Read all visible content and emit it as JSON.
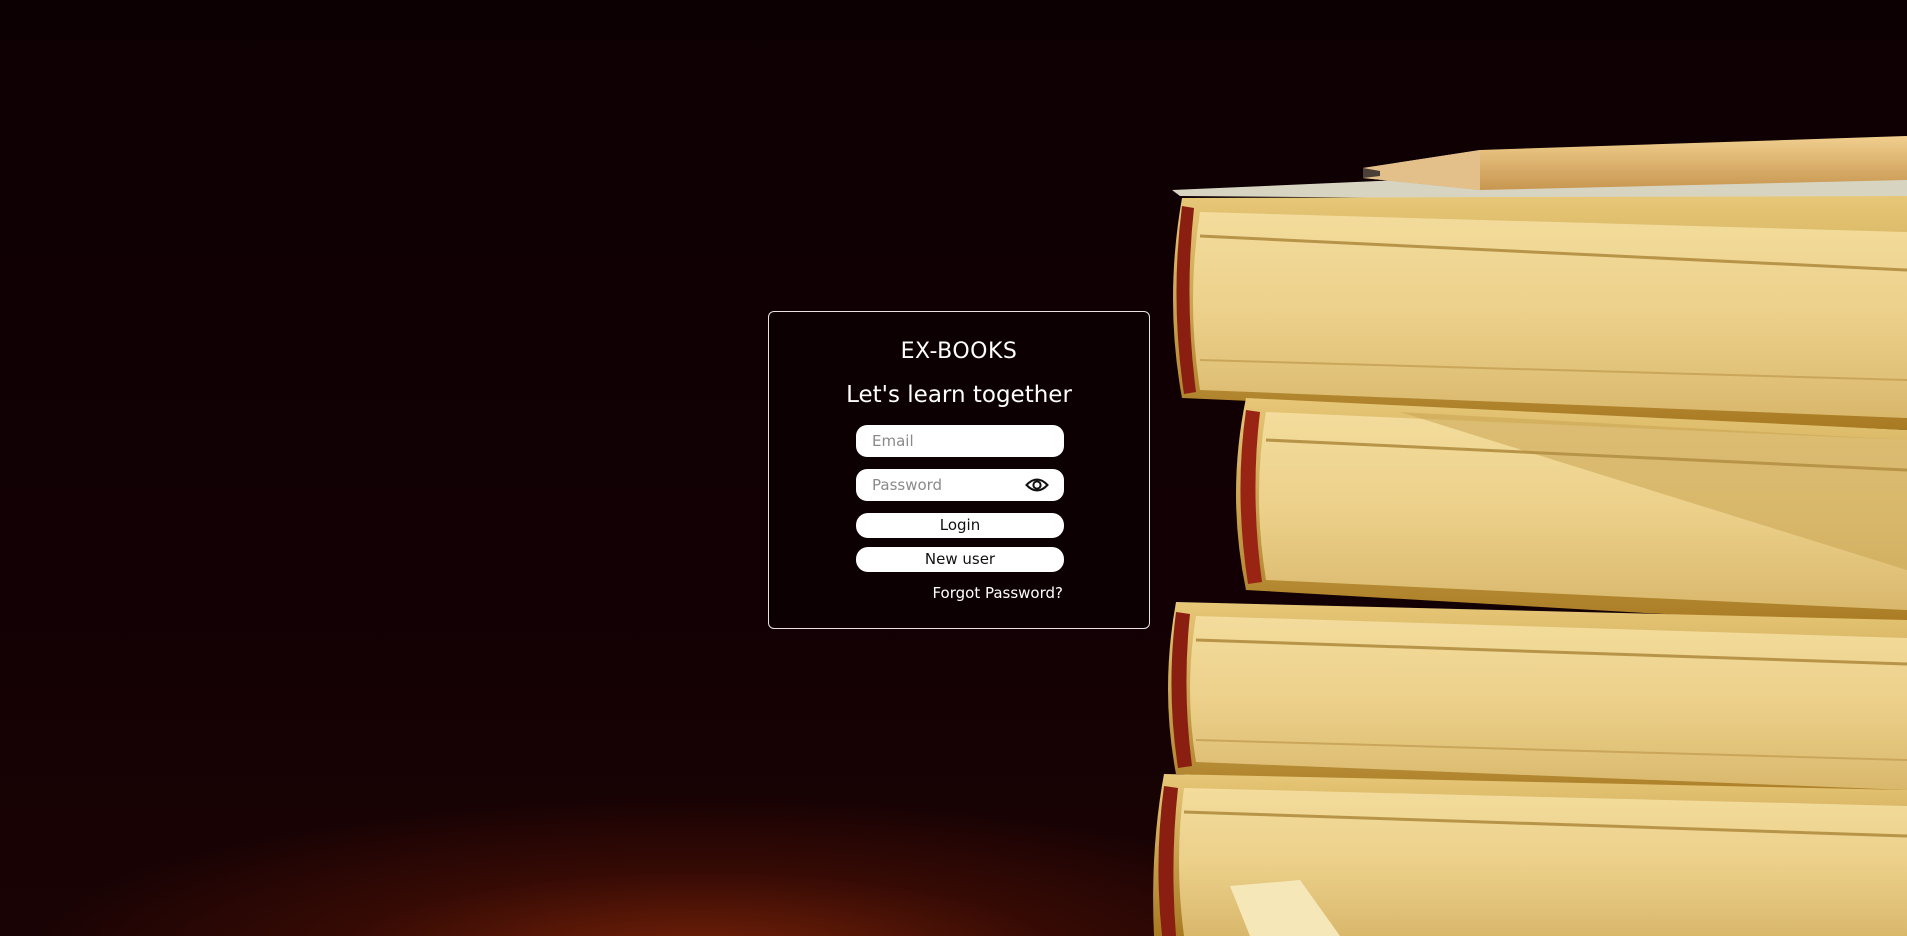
{
  "app": {
    "brand": "EX-BOOKS",
    "tagline": "Let's learn together"
  },
  "form": {
    "email": {
      "placeholder": "Email",
      "value": ""
    },
    "password": {
      "placeholder": "Password",
      "value": ""
    },
    "show_password_icon": "eye-icon",
    "login_label": "Login",
    "new_user_label": "New user",
    "forgot_label": "Forgot Password?"
  },
  "background": {
    "subject": "books-stack-with-pencil",
    "colors": {
      "backdrop": "#0d0003",
      "page_edges": "#ecd08a",
      "cover_spine": "#b8861d",
      "glow": "#962d0a"
    }
  }
}
